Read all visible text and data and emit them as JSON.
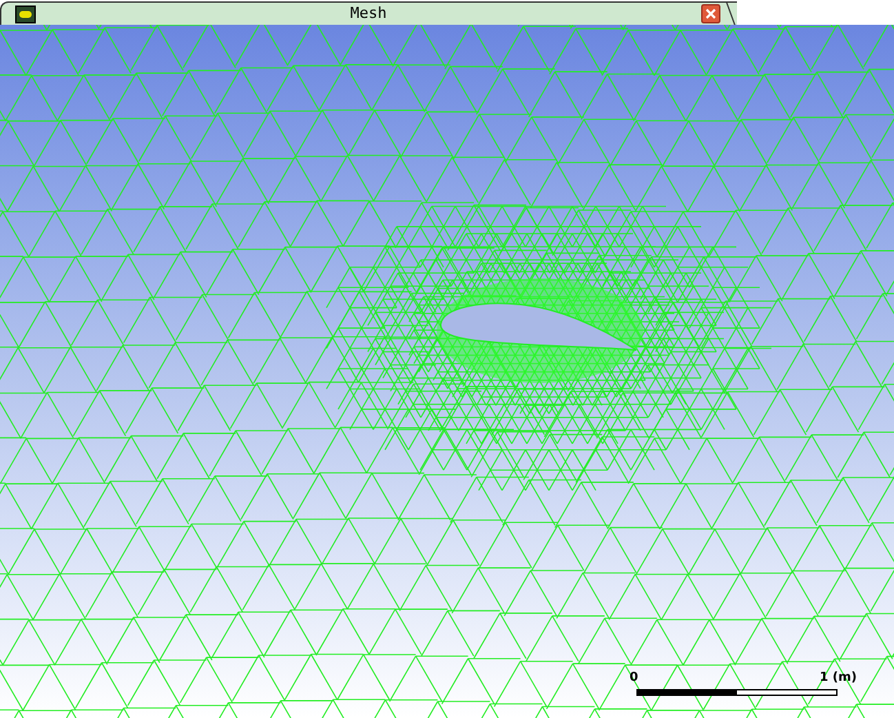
{
  "window": {
    "title": "Mesh"
  },
  "scale_bar": {
    "start_label": "0",
    "end_label": "1 (m)"
  }
}
